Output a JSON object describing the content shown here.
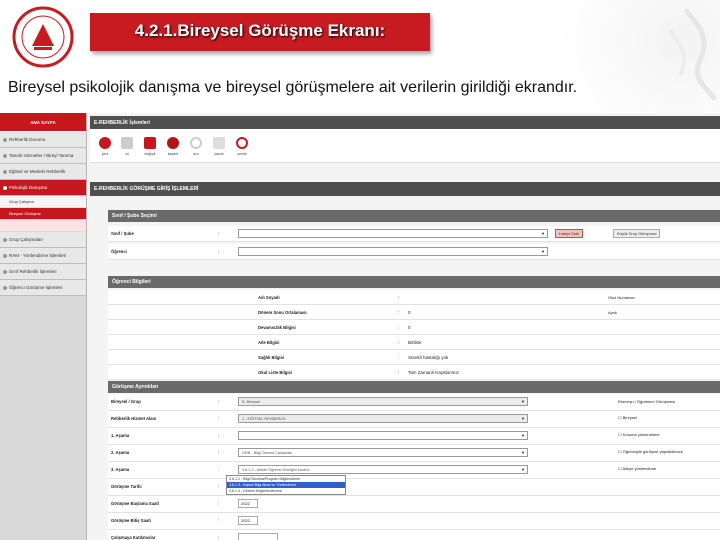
{
  "slide": {
    "title": "4.2.1.Bireysel  Görüşme  Ekranı:",
    "subtitle": "Bireysel psikolojik danışma ve bireysel görüşmelere ait verilerin girildiği ekrandır.",
    "brand_color": "#c71b21"
  },
  "seal": {
    "text": "T.C. MİLLÎ EĞİTİM BAKANLIĞI"
  },
  "sidebar": {
    "head": "ANA SAYFA",
    "items": [
      {
        "label": "Rehberlik Durumu"
      },
      {
        "label": "Tanıtık Hizmetler / Bireyi Tanıma"
      },
      {
        "label": "Eğitsel ve Mesleki Rehberlik"
      },
      {
        "label": "Psikolojik Danışma"
      },
      {
        "label": "Bireysel Çalışmalar"
      },
      {
        "label": "Grup Çalışmaları"
      },
      {
        "label": "RAM - Yönlendirme İşlemleri"
      },
      {
        "label": "Sınıf Rehberlik İşlemleri"
      },
      {
        "label": "Öğrenci Görüşme İşlemleri"
      }
    ],
    "sub": [
      "Grup Çalışma",
      "Bireysel Görüşme"
    ]
  },
  "main": {
    "bar1": "E-REHBERLİK İşlemleri",
    "toolbar": [
      "yeni",
      "sil",
      "değişik",
      "kaydet",
      "ara",
      "yazdır",
      "yenile"
    ],
    "bar2": "E-REHBERLİK GÖRÜŞME GİRİŞ İŞLEMLERİ",
    "sec1": "Sınıf / Şube Seçimi",
    "sinif_label": "Sınıf / Şube",
    "ogrenci_label": "Öğrenci",
    "btn_liste": "Listeyi Getir",
    "btn_kucuk": "Küçük Grup Görüşmesi",
    "sec2": "Öğrenci Bilgileri",
    "info": [
      {
        "label": "Adı Soyadı",
        "value": ""
      },
      {
        "label": "Dönem Sonu Ortalaması",
        "value": "0"
      },
      {
        "label": "Devamsızlık Bilgisi",
        "value": "0"
      },
      {
        "label": "Aile Bilgisi",
        "value": "Birlikte"
      },
      {
        "label": "Sağlık Bilgisi",
        "value": "Sürekli hastalığı yok"
      },
      {
        "label": "Okul Liste Bilgisi",
        "value": "Tam Zamanlı Kayıtlarımız"
      }
    ],
    "okul_no": "Okul Numarası",
    "ayrik": "Ayrık",
    "sec3": "Görüşme Ayrıntıları",
    "fields": [
      {
        "label": "Bireysel / Grup",
        "value": "B. Bireysel"
      },
      {
        "label": "Rehberlik Hizmet Alanı",
        "value": "1 - EĞİTSEL REHBERLİK"
      },
      {
        "label": "1. Aşama",
        "value": ""
      },
      {
        "label": "2. Aşama",
        "value": "ORB - Bilgi Tanıma Çalışması"
      },
      {
        "label": "3. Aşama",
        "value": "3.6.1.2 - Ailede Öğrenci Kimliğini kontrol"
      }
    ],
    "right_head": "Ebeveyn / Öğretmen Görüşmesi",
    "right_opts": [
      "Bireysel",
      "Kuruma yönlendirme",
      "Öğrenciyle görüşme yapılabilecek",
      "Aileye yönlendirme"
    ],
    "lower": [
      {
        "label": "Görüşme Tarihi",
        "value": ""
      },
      {
        "label": "Görüşme Başlama Saati",
        "value": "2022"
      },
      {
        "label": "Görüşme Bitiş Saati",
        "value": "2022"
      },
      {
        "label": "Çalışmaya Katılımcılar",
        "value": ""
      }
    ],
    "dropdown": [
      "3.6.1.2 - Bilgi/Tanıtma/Program Bilgilendirme",
      "3.6.1.3 - Kişisel Bilgi Alma ve Yönlendirme",
      "3.6.1.4 - Dönem Değerlendirmesi"
    ]
  }
}
